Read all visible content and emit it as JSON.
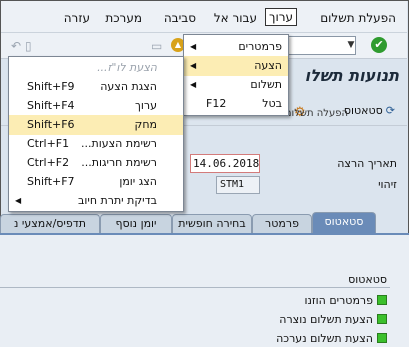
{
  "menubar": {
    "items": [
      {
        "label": "הפעלת תשלום"
      },
      {
        "label": "ערוך"
      },
      {
        "label": "עבור אל"
      },
      {
        "label": "סביבה"
      },
      {
        "label": "מערכת"
      },
      {
        "label": "עזרה"
      }
    ]
  },
  "toolbar": {
    "ok_symbol": "✔"
  },
  "page": {
    "title": "תנועות תשלו",
    "status_button": "סטאטוס",
    "fragment_left": "הפעלה תשלום ל"
  },
  "fields": {
    "date_label": "תאריך הרצה",
    "date_value": "14.06.2018",
    "id_label": "זיהוי",
    "id_value": "STM1"
  },
  "tabs": [
    {
      "label": "סטאטוס"
    },
    {
      "label": "פרמטר"
    },
    {
      "label": "בחירה חופשית"
    },
    {
      "label": "יומן נוסף"
    },
    {
      "label": "תדפיס/אמצעי נ"
    }
  ],
  "status_group": {
    "title": "סטאטוס",
    "rows": [
      {
        "label": "פרמטרים הוזנו"
      },
      {
        "label": "הצעת תשלום נוצרה"
      },
      {
        "label": "הצעת תשלום נערכה"
      }
    ]
  },
  "edit_menu": {
    "items": [
      {
        "label": "פרמטרים"
      },
      {
        "label": "הצעה"
      },
      {
        "label": "תשלום"
      },
      {
        "label": "בטל",
        "shortcut": "F12"
      }
    ]
  },
  "proposal_menu": {
    "items": [
      {
        "label": "הצעת לו\"ז..."
      },
      {
        "label": "הצגת הצעה",
        "shortcut": "Shift+F9"
      },
      {
        "label": "ערוך",
        "shortcut": "Shift+F4"
      },
      {
        "label": "מחק",
        "shortcut": "Shift+F6"
      },
      {
        "label": "רשימת הצעות...",
        "shortcut": "Ctrl+F1"
      },
      {
        "label": "רשימת חריגות...",
        "shortcut": "Ctrl+F2"
      },
      {
        "label": "הצג יומן",
        "shortcut": "Shift+F7"
      },
      {
        "label": "בדיקת יתרת חיוב"
      }
    ]
  }
}
